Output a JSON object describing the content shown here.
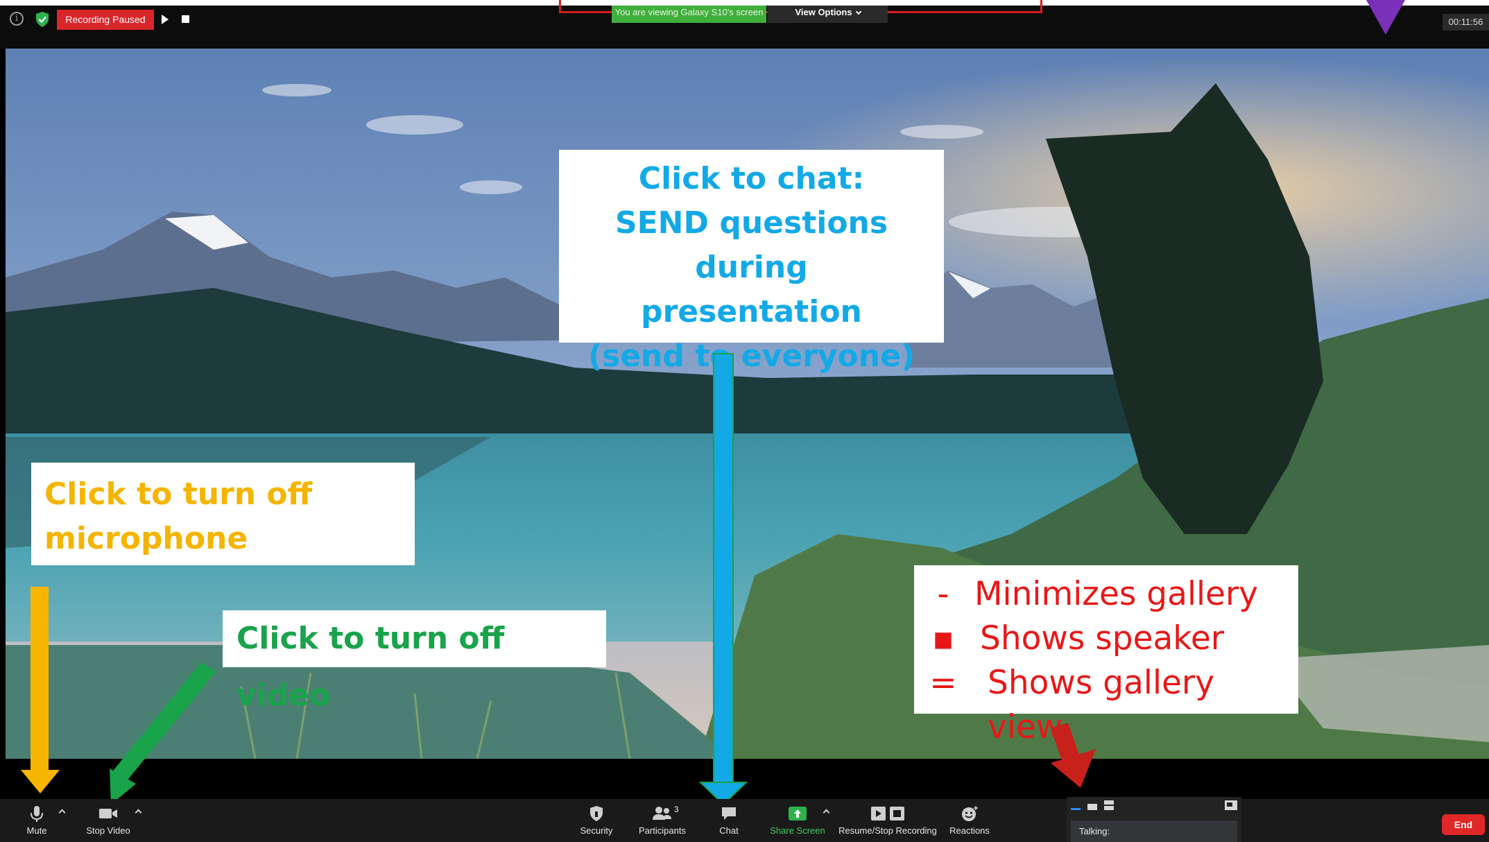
{
  "top_bar": {
    "recording_status": "Recording Paused",
    "viewing_banner": "You are viewing Galaxy S10's screen",
    "view_options_label": "View Options",
    "elapsed_time": "00:11:56"
  },
  "annotations": {
    "chat": [
      "Click to chat:",
      "SEND questions during",
      "presentation",
      "(send to everyone)"
    ],
    "microphone": [
      "Click to turn off",
      "microphone"
    ],
    "video": "Click to turn off video",
    "gallery": [
      {
        "symbol": "-",
        "text": "Minimizes gallery"
      },
      {
        "symbol": "▪",
        "text": "Shows speaker"
      },
      {
        "symbol": "=",
        "text": "Shows gallery view"
      }
    ],
    "colors": {
      "chat": "#12a9e6",
      "microphone": "#f5b400",
      "video": "#19a34a",
      "gallery": "#e81717",
      "corner_arrow": "#7a30b8"
    }
  },
  "toolbar": {
    "mute_label": "Mute",
    "stop_video_label": "Stop Video",
    "security_label": "Security",
    "participants_label": "Participants",
    "participants_count": "3",
    "chat_label": "Chat",
    "share_screen_label": "Share Screen",
    "recording_label": "Resume/Stop Recording",
    "reactions_label": "Reactions",
    "end_label": "End",
    "talking_label": "Talking:"
  }
}
